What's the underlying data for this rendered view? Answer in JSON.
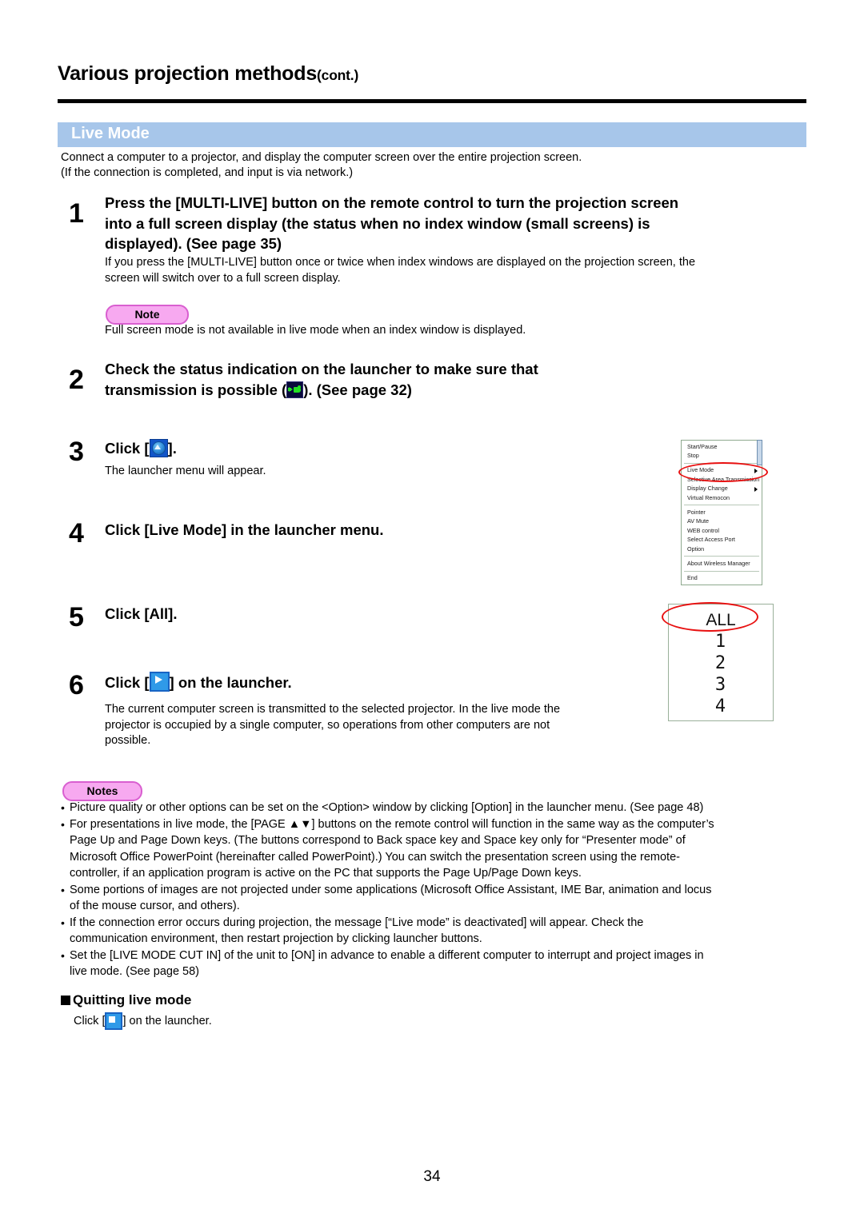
{
  "header": {
    "title": "Various projection methods",
    "title_suffix": "(cont.)"
  },
  "section": {
    "banner_label": "Live Mode",
    "banner_color": "#a7c6ea",
    "intro_line1": "Connect a computer to a projector, and display the computer screen over the entire projection screen.",
    "intro_line2": "(If the connection is completed, and input is via network.)"
  },
  "steps": [
    {
      "number": "1",
      "heading_line1": "Press the [MULTI-LIVE] button on the remote control to turn the projection screen",
      "heading_line2": "into a full screen display (the status when no index window (small screens) is",
      "heading_line3": "displayed). (See page 35)",
      "body_line1": "If you press the [MULTI-LIVE] button once or twice when index windows are displayed on the projection screen, the",
      "body_line2": "screen will switch over to a full screen display."
    },
    {
      "number": "2",
      "heading_line1": "Check the status indication on the launcher to make sure that",
      "heading_prefix2": "transmission is possible (",
      "heading_suffix2": "). (See page 32)",
      "icon": "transmission-status-icon"
    },
    {
      "number": "3",
      "heading_prefix": "Click [",
      "heading_suffix": "].",
      "icon": "launcher-menu-button-icon",
      "body_line1": "The launcher menu will appear."
    },
    {
      "number": "4",
      "heading_line1": "Click [Live Mode] in the launcher menu."
    },
    {
      "number": "5",
      "heading_line1": "Click [All]."
    },
    {
      "number": "6",
      "heading_prefix": "Click [",
      "heading_suffix": "] on the launcher.",
      "icon": "play-transmit-icon",
      "body_line1": "The current computer screen is transmitted to the selected projector. In the live mode the",
      "body_line2": "projector is occupied by a single computer, so operations from other computers are not",
      "body_line3": "possible."
    }
  ],
  "note_single": {
    "badge": "Note",
    "badge_bg": "#f7a9f0",
    "badge_border": "#d95fd0",
    "text": "Full screen mode is not available in live mode when an index window is displayed."
  },
  "notes_block": {
    "badge": "Notes",
    "bullet": "•",
    "items": [
      [
        "Picture quality or other options can be set on the <Option> window by clicking [Option] in the launcher menu. (See page 48)"
      ],
      [
        "For presentations in live mode, the [PAGE ▲▼] buttons on the remote control will function in the same way as the computer’s",
        "Page Up and Page Down keys. (The buttons correspond to Back space key and Space key only for “Presenter mode” of",
        "Microsoft Office PowerPoint (hereinafter called PowerPoint).) You can switch the presentation screen using the remote-",
        "controller, if an application program is active on the PC that supports the Page Up/Page Down keys."
      ],
      [
        "Some portions of images are not projected under some applications (Microsoft Office Assistant, IME Bar, animation and locus",
        "of the mouse cursor, and others)."
      ],
      [
        "If the connection error occurs during projection, the message [“Live mode” is deactivated] will appear. Check the",
        "communication environment, then restart projection by clicking launcher buttons."
      ],
      [
        "Set the [LIVE MODE CUT IN] of the unit to [ON] in advance to enable a different computer to interrupt and project images in",
        "live mode. (See page 58)"
      ]
    ]
  },
  "subsection": {
    "heading": "Quitting live mode",
    "body_prefix": "Click [",
    "body_suffix": "] on the launcher.",
    "icon": "stop-transmit-icon"
  },
  "launcher_menu": {
    "highlight_color": "#e81010",
    "highlighted_item": "Live Mode",
    "groups": [
      {
        "items": [
          {
            "label": "Start/Pause",
            "submenu": false
          },
          {
            "label": "Stop",
            "submenu": false
          }
        ]
      },
      {
        "items": [
          {
            "label": "Live Mode",
            "submenu": true
          },
          {
            "label": "Selective Area Transmission",
            "submenu": false
          },
          {
            "label": "Display Change",
            "submenu": true
          },
          {
            "label": "Virtual Remocon",
            "submenu": false
          }
        ]
      },
      {
        "items": [
          {
            "label": "Pointer",
            "submenu": false
          },
          {
            "label": "AV Mute",
            "submenu": false
          },
          {
            "label": "WEB control",
            "submenu": false
          },
          {
            "label": "Select Access Port",
            "submenu": false
          },
          {
            "label": "Option",
            "submenu": false
          }
        ]
      },
      {
        "items": [
          {
            "label": "About Wireless Manager",
            "submenu": false
          }
        ]
      },
      {
        "items": [
          {
            "label": "End",
            "submenu": false
          }
        ]
      }
    ]
  },
  "all_box": {
    "highlighted_item": "ALL",
    "rows": [
      "ALL",
      "1",
      "2",
      "3",
      "4"
    ]
  },
  "footer": {
    "page_number": "34"
  }
}
